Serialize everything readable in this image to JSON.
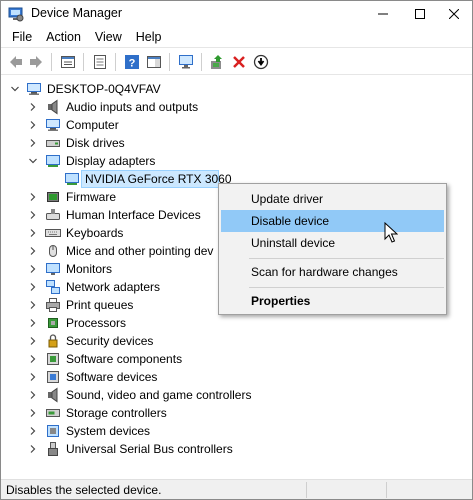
{
  "window": {
    "title": "Device Manager"
  },
  "menu": [
    "File",
    "Action",
    "View",
    "Help"
  ],
  "toolbar": {
    "buttons": [
      "back-icon",
      "forward-icon",
      "properties-sheet-icon",
      "show-hide-icon",
      "help-icon",
      "action-pane-icon",
      "monitor-scan-icon",
      "add-driver-icon",
      "uninstall-icon",
      "update-driver-icon"
    ]
  },
  "tree": {
    "root": "DESKTOP-0Q4VFAV",
    "items": [
      {
        "label": "Audio inputs and outputs",
        "icon": "speaker-icon",
        "expanded": false
      },
      {
        "label": "Computer",
        "icon": "computer-icon",
        "expanded": false
      },
      {
        "label": "Disk drives",
        "icon": "disk-drive-icon",
        "expanded": false
      },
      {
        "label": "Display adapters",
        "icon": "display-adapter-icon",
        "expanded": true
      },
      {
        "label": "Firmware",
        "icon": "firmware-icon",
        "expanded": false
      },
      {
        "label": "Human Interface Devices",
        "icon": "hid-icon",
        "expanded": false
      },
      {
        "label": "Keyboards",
        "icon": "keyboard-icon",
        "expanded": false
      },
      {
        "label": "Mice and other pointing dev",
        "icon": "mouse-icon",
        "expanded": false
      },
      {
        "label": "Monitors",
        "icon": "monitor-icon",
        "expanded": false
      },
      {
        "label": "Network adapters",
        "icon": "network-icon",
        "expanded": false
      },
      {
        "label": "Print queues",
        "icon": "printer-icon",
        "expanded": false
      },
      {
        "label": "Processors",
        "icon": "processor-icon",
        "expanded": false
      },
      {
        "label": "Security devices",
        "icon": "security-icon",
        "expanded": false
      },
      {
        "label": "Software components",
        "icon": "software-component-icon",
        "expanded": false
      },
      {
        "label": "Software devices",
        "icon": "software-device-icon",
        "expanded": false
      },
      {
        "label": "Sound, video and game controllers",
        "icon": "sound-icon",
        "expanded": false
      },
      {
        "label": "Storage controllers",
        "icon": "storage-icon",
        "expanded": false
      },
      {
        "label": "System devices",
        "icon": "system-icon",
        "expanded": false
      },
      {
        "label": "Universal Serial Bus controllers",
        "icon": "usb-icon",
        "expanded": false
      }
    ],
    "child": "NVIDIA GeForce RTX 3060"
  },
  "context_menu": {
    "items": [
      "Update driver",
      "Disable device",
      "Uninstall device",
      "Scan for hardware changes",
      "Properties"
    ],
    "highlighted": "Disable device"
  },
  "status": {
    "text": "Disables the selected device."
  },
  "colors": {
    "selection": "#cce8ff",
    "menu_highlight": "#91c9f7",
    "menu_bg": "#f2f2f2"
  }
}
